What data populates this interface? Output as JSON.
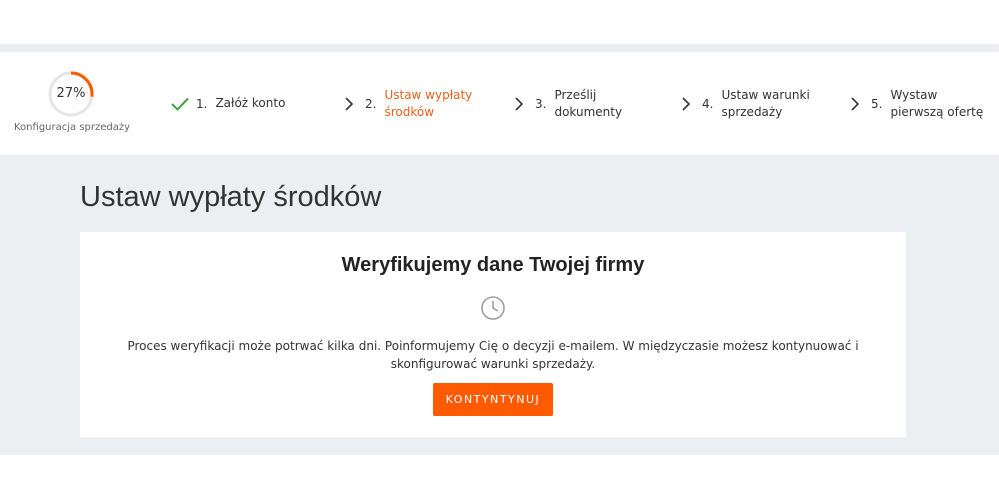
{
  "colors": {
    "accent": "#ff5a00",
    "current_step": "#e8601d",
    "done_check": "#43a047",
    "background_gray": "#eceff1"
  },
  "progress": {
    "value": "27%",
    "fraction": 0.27,
    "label": "Konfiguracja sprzedaży"
  },
  "steps": [
    {
      "number": "1.",
      "label": "Załóż konto",
      "icon": "check-icon",
      "state": "done"
    },
    {
      "number": "2.",
      "label": "Ustaw wypłaty środków",
      "icon": "chevron-right-icon",
      "state": "current"
    },
    {
      "number": "3.",
      "label": "Prześlij dokumenty",
      "icon": "chevron-right-icon",
      "state": "todo"
    },
    {
      "number": "4.",
      "label": "Ustaw warunki sprzedaży",
      "icon": "chevron-right-icon",
      "state": "todo"
    },
    {
      "number": "5.",
      "label": "Wystaw pierwszą ofertę",
      "icon": "chevron-right-icon",
      "state": "todo"
    }
  ],
  "main": {
    "title": "Ustaw wypłaty środków",
    "card": {
      "title": "Weryfikujemy dane Twojej firmy",
      "icon": "clock-icon",
      "text": "Proces weryfikacji może potrwać kilka dni. Poinformujemy Cię o decyzji e-mailem. W międzyczasie możesz kontynuować i skonfigurować warunki sprzedaży.",
      "button_label": "KONTYNTYNUJ"
    }
  }
}
